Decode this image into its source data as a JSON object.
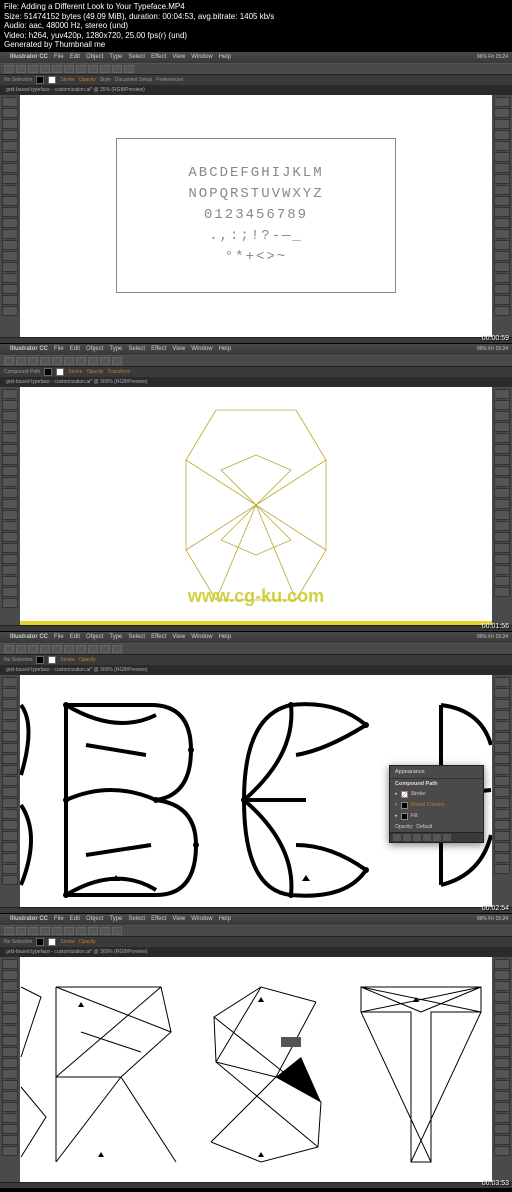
{
  "header": {
    "file": "File: Adding a Different Look to Your Typeface.MP4",
    "size": "Size: 51474152 bytes (49.09 MiB), duration: 00:04:53, avg.bitrate: 1405 kb/s",
    "audio": "Audio: aac, 48000 Hz, stereo (und)",
    "video": "Video: h264, yuv420p, 1280x720, 25.00 fps(r) (und)",
    "generated": "Generated by Thumbnail me"
  },
  "menubar": {
    "app": "Illustrator CC",
    "items": [
      "File",
      "Edit",
      "Object",
      "Type",
      "Select",
      "Effect",
      "View",
      "Window",
      "Help"
    ],
    "right_status": "96% Fri 15:24"
  },
  "control": {
    "no_selection": "No Selection",
    "compound": "Compound Path",
    "stroke": "Stroke",
    "opacity": "Opacity",
    "style": "Style",
    "doc_setup": "Document Setup",
    "prefs": "Preferences",
    "transform": "Transform"
  },
  "doc_tabs": {
    "s1": "grid-based typeface - customization.ai* @ 25% (RGB/Preview)",
    "s2": "grid-based typeface - customization.ai* @ 300% (RGB/Preview)",
    "s3": "grid-based typeface - customization.ai* @ 300% (RGB/Preview)",
    "s4": "grid-based typeface - customization.ai* @ 300% (RGB/Preview)"
  },
  "typeface": {
    "line1": "ABCDEFGHIJKLM",
    "line2": "NOPQRSTUVWXYZ",
    "line3": "0123456789",
    "line4": ".,:;!?-—_",
    "line5": "°*+<>~"
  },
  "watermark": "www.cg-ku.com",
  "appearance": {
    "tab": "Appearance",
    "title": "Compound Path",
    "stroke": "Stroke:",
    "fill": "Fill:",
    "fill1_label": "Round Corners",
    "opacity": "Opacity:",
    "default": "Default"
  },
  "timestamps": {
    "s1": "00:00:59",
    "s2": "00:01:56",
    "s3": "00:02:54",
    "s4": "00:03:53"
  }
}
